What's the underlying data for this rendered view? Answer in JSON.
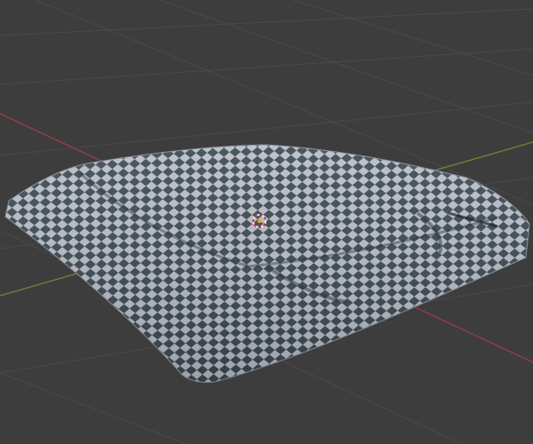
{
  "viewport": {
    "type": "3d-viewport",
    "background_color": "#3d3d3d",
    "grid_color": "#4a4a4a",
    "x_axis_color": "#9a3c45",
    "y_axis_color": "#6a8a32",
    "mesh": {
      "material": "checker",
      "light_color": "#b9bdc9",
      "dark_color": "#3b4a50"
    },
    "cursor_icon": "3d-cursor-icon"
  }
}
